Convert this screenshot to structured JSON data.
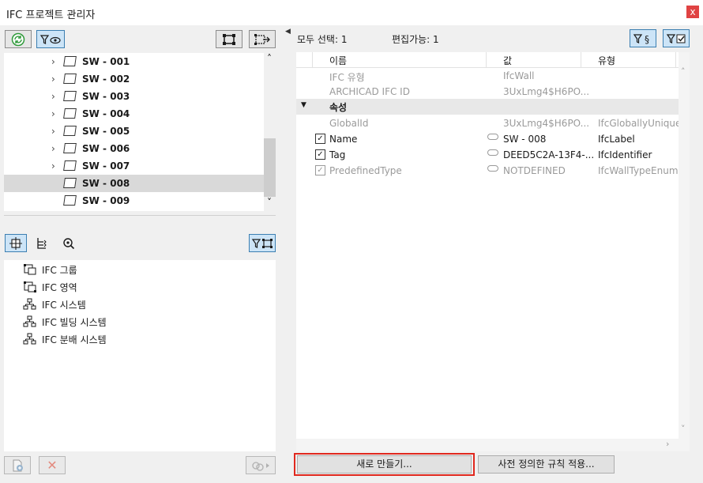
{
  "window": {
    "title": "IFC 프로젝트 관리자",
    "close_glyph": "x"
  },
  "tree": {
    "items": [
      {
        "label": "SW - 001",
        "expandable": true
      },
      {
        "label": "SW - 002",
        "expandable": true
      },
      {
        "label": "SW - 003",
        "expandable": true
      },
      {
        "label": "SW - 004",
        "expandable": true
      },
      {
        "label": "SW - 005",
        "expandable": true
      },
      {
        "label": "SW - 006",
        "expandable": true
      },
      {
        "label": "SW - 007",
        "expandable": true
      },
      {
        "label": "SW - 008",
        "expandable": false,
        "selected": true
      },
      {
        "label": "SW - 009",
        "expandable": false
      }
    ]
  },
  "groups": {
    "items": [
      {
        "label": "IFC 그룹",
        "icon": "ifc-group-icon"
      },
      {
        "label": "IFC 영역",
        "icon": "ifc-zone-icon"
      },
      {
        "label": "IFC 시스템",
        "icon": "ifc-system-icon"
      },
      {
        "label": "IFC 빌딩 시스템",
        "icon": "ifc-building-system-icon"
      },
      {
        "label": "IFC 분배 시스템",
        "icon": "ifc-distribution-system-icon"
      }
    ]
  },
  "status": {
    "all_selected": "모두 선택: 1",
    "editable": "편집가능: 1"
  },
  "props": {
    "headers": {
      "name": "이름",
      "value": "값",
      "type": "유형"
    },
    "rows_top": [
      {
        "name": "IFC 유형",
        "value": "IfcWall",
        "type": ""
      },
      {
        "name": "ARCHICAD IFC ID",
        "value": "3UxLmg4$H6PO...",
        "type": ""
      }
    ],
    "section": "속성",
    "rows_attr": [
      {
        "name": "GlobalId",
        "value": "3UxLmg4$H6PO...",
        "type": "IfcGloballyUniqueId",
        "check": "none",
        "link": false,
        "dim": true
      },
      {
        "name": "Name",
        "value": "SW - 008",
        "type": "IfcLabel",
        "check": "on",
        "link": true,
        "dim": false
      },
      {
        "name": "Tag",
        "value": "DEED5C2A-13F4-...",
        "type": "IfcIdentifier",
        "check": "on",
        "link": true,
        "dim": false
      },
      {
        "name": "PredefinedType",
        "value": "NOTDEFINED",
        "type": "IfcWallTypeEnum",
        "check": "dim",
        "link": true,
        "dim": true
      }
    ]
  },
  "buttons": {
    "new": "새로 만들기...",
    "apply_rules": "사전 정의한 규칙 적용..."
  },
  "glyphs": {
    "checkmark": "✓",
    "chevron_right": "›",
    "chevron_up": "˄",
    "chevron_down": "˅",
    "triangle_down": "▼",
    "triangle_left": "◀",
    "close_x": "✕"
  },
  "colors": {
    "highlight_border": "#e0281e",
    "selection": "#d9d9d9",
    "toggle_blue": "#cce4f7"
  }
}
